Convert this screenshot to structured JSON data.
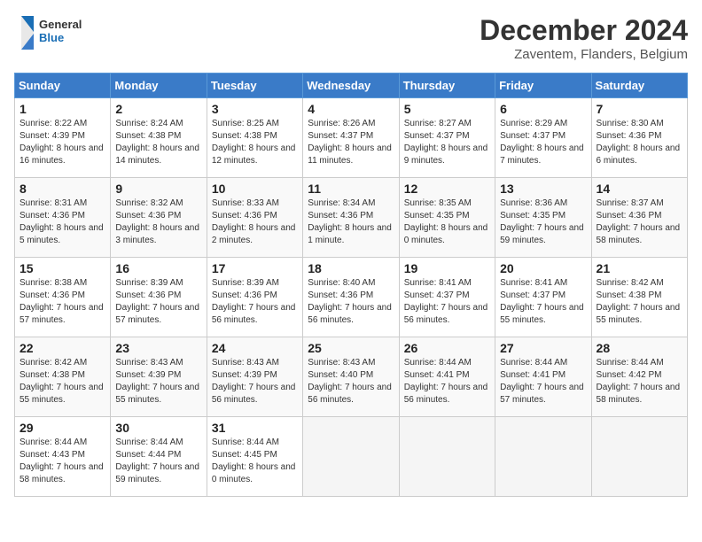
{
  "header": {
    "logo_general": "General",
    "logo_blue": "Blue",
    "month_title": "December 2024",
    "subtitle": "Zaventem, Flanders, Belgium"
  },
  "weekdays": [
    "Sunday",
    "Monday",
    "Tuesday",
    "Wednesday",
    "Thursday",
    "Friday",
    "Saturday"
  ],
  "weeks": [
    [
      {
        "day": "1",
        "sunrise": "8:22 AM",
        "sunset": "4:39 PM",
        "daylight": "8 hours and 16 minutes."
      },
      {
        "day": "2",
        "sunrise": "8:24 AM",
        "sunset": "4:38 PM",
        "daylight": "8 hours and 14 minutes."
      },
      {
        "day": "3",
        "sunrise": "8:25 AM",
        "sunset": "4:38 PM",
        "daylight": "8 hours and 12 minutes."
      },
      {
        "day": "4",
        "sunrise": "8:26 AM",
        "sunset": "4:37 PM",
        "daylight": "8 hours and 11 minutes."
      },
      {
        "day": "5",
        "sunrise": "8:27 AM",
        "sunset": "4:37 PM",
        "daylight": "8 hours and 9 minutes."
      },
      {
        "day": "6",
        "sunrise": "8:29 AM",
        "sunset": "4:37 PM",
        "daylight": "8 hours and 7 minutes."
      },
      {
        "day": "7",
        "sunrise": "8:30 AM",
        "sunset": "4:36 PM",
        "daylight": "8 hours and 6 minutes."
      }
    ],
    [
      {
        "day": "8",
        "sunrise": "8:31 AM",
        "sunset": "4:36 PM",
        "daylight": "8 hours and 5 minutes."
      },
      {
        "day": "9",
        "sunrise": "8:32 AM",
        "sunset": "4:36 PM",
        "daylight": "8 hours and 3 minutes."
      },
      {
        "day": "10",
        "sunrise": "8:33 AM",
        "sunset": "4:36 PM",
        "daylight": "8 hours and 2 minutes."
      },
      {
        "day": "11",
        "sunrise": "8:34 AM",
        "sunset": "4:36 PM",
        "daylight": "8 hours and 1 minute."
      },
      {
        "day": "12",
        "sunrise": "8:35 AM",
        "sunset": "4:35 PM",
        "daylight": "8 hours and 0 minutes."
      },
      {
        "day": "13",
        "sunrise": "8:36 AM",
        "sunset": "4:35 PM",
        "daylight": "7 hours and 59 minutes."
      },
      {
        "day": "14",
        "sunrise": "8:37 AM",
        "sunset": "4:36 PM",
        "daylight": "7 hours and 58 minutes."
      }
    ],
    [
      {
        "day": "15",
        "sunrise": "8:38 AM",
        "sunset": "4:36 PM",
        "daylight": "7 hours and 57 minutes."
      },
      {
        "day": "16",
        "sunrise": "8:39 AM",
        "sunset": "4:36 PM",
        "daylight": "7 hours and 57 minutes."
      },
      {
        "day": "17",
        "sunrise": "8:39 AM",
        "sunset": "4:36 PM",
        "daylight": "7 hours and 56 minutes."
      },
      {
        "day": "18",
        "sunrise": "8:40 AM",
        "sunset": "4:36 PM",
        "daylight": "7 hours and 56 minutes."
      },
      {
        "day": "19",
        "sunrise": "8:41 AM",
        "sunset": "4:37 PM",
        "daylight": "7 hours and 56 minutes."
      },
      {
        "day": "20",
        "sunrise": "8:41 AM",
        "sunset": "4:37 PM",
        "daylight": "7 hours and 55 minutes."
      },
      {
        "day": "21",
        "sunrise": "8:42 AM",
        "sunset": "4:38 PM",
        "daylight": "7 hours and 55 minutes."
      }
    ],
    [
      {
        "day": "22",
        "sunrise": "8:42 AM",
        "sunset": "4:38 PM",
        "daylight": "7 hours and 55 minutes."
      },
      {
        "day": "23",
        "sunrise": "8:43 AM",
        "sunset": "4:39 PM",
        "daylight": "7 hours and 55 minutes."
      },
      {
        "day": "24",
        "sunrise": "8:43 AM",
        "sunset": "4:39 PM",
        "daylight": "7 hours and 56 minutes."
      },
      {
        "day": "25",
        "sunrise": "8:43 AM",
        "sunset": "4:40 PM",
        "daylight": "7 hours and 56 minutes."
      },
      {
        "day": "26",
        "sunrise": "8:44 AM",
        "sunset": "4:41 PM",
        "daylight": "7 hours and 56 minutes."
      },
      {
        "day": "27",
        "sunrise": "8:44 AM",
        "sunset": "4:41 PM",
        "daylight": "7 hours and 57 minutes."
      },
      {
        "day": "28",
        "sunrise": "8:44 AM",
        "sunset": "4:42 PM",
        "daylight": "7 hours and 58 minutes."
      }
    ],
    [
      {
        "day": "29",
        "sunrise": "8:44 AM",
        "sunset": "4:43 PM",
        "daylight": "7 hours and 58 minutes."
      },
      {
        "day": "30",
        "sunrise": "8:44 AM",
        "sunset": "4:44 PM",
        "daylight": "7 hours and 59 minutes."
      },
      {
        "day": "31",
        "sunrise": "8:44 AM",
        "sunset": "4:45 PM",
        "daylight": "8 hours and 0 minutes."
      },
      null,
      null,
      null,
      null
    ]
  ],
  "colors": {
    "header_bg": "#3a7bc8",
    "accent_blue": "#1a6eb5"
  }
}
